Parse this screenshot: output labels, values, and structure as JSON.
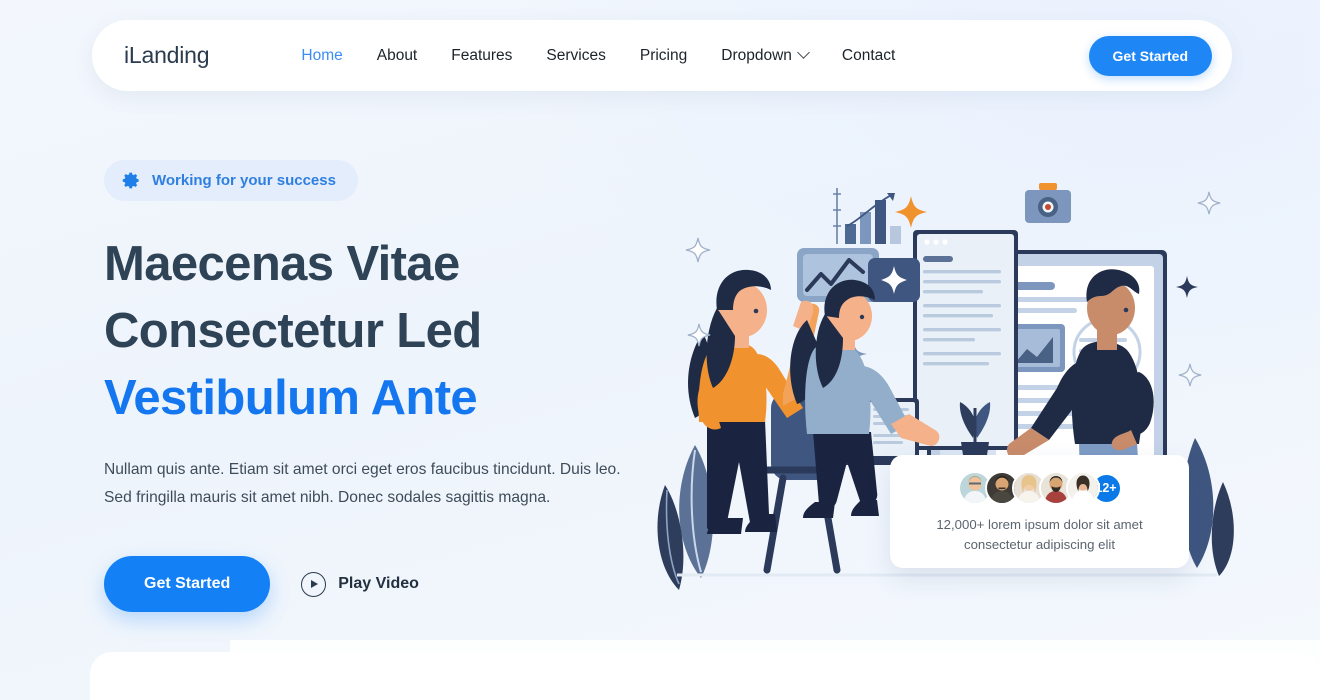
{
  "header": {
    "brand": "iLanding",
    "nav": [
      {
        "label": "Home",
        "active": true,
        "dropdown": false
      },
      {
        "label": "About",
        "active": false,
        "dropdown": false
      },
      {
        "label": "Features",
        "active": false,
        "dropdown": false
      },
      {
        "label": "Services",
        "active": false,
        "dropdown": false
      },
      {
        "label": "Pricing",
        "active": false,
        "dropdown": false
      },
      {
        "label": "Dropdown",
        "active": false,
        "dropdown": true
      },
      {
        "label": "Contact",
        "active": false,
        "dropdown": false
      }
    ],
    "cta_label": "Get Started"
  },
  "hero": {
    "badge": {
      "icon": "gear-icon",
      "text": "Working for your success"
    },
    "title_line1": "Maecenas Vitae",
    "title_line2": "Consectetur Led",
    "title_line3": "Vestibulum Ante",
    "desc_line1": "Nullam quis ante. Etiam sit amet orci eget eros faucibus tincidunt. Duis leo.",
    "desc_line2": "Sed fringilla mauris sit amet nibh. Donec sodales sagittis magna.",
    "primary_cta": "Get Started",
    "video_cta": "Play Video"
  },
  "testimonial": {
    "avatar_count": 5,
    "more_badge": "12+",
    "line1": "12,000+ lorem ipsum dolor sit amet",
    "line2": "consectetur adipiscing elit"
  },
  "colors": {
    "page_bg": "#f2f6fd",
    "accent_blue": "#1380f6",
    "nav_active": "#3b8df4",
    "heading_dark": "#2e4356",
    "heading_accent": "#1477f0",
    "badge_bg": "#e3edfb",
    "badge_text": "#2f7fe0",
    "illustration_navy": "#2b3a5a",
    "illustration_orange": "#f0932f",
    "illustration_slate": "#7d96bd"
  }
}
